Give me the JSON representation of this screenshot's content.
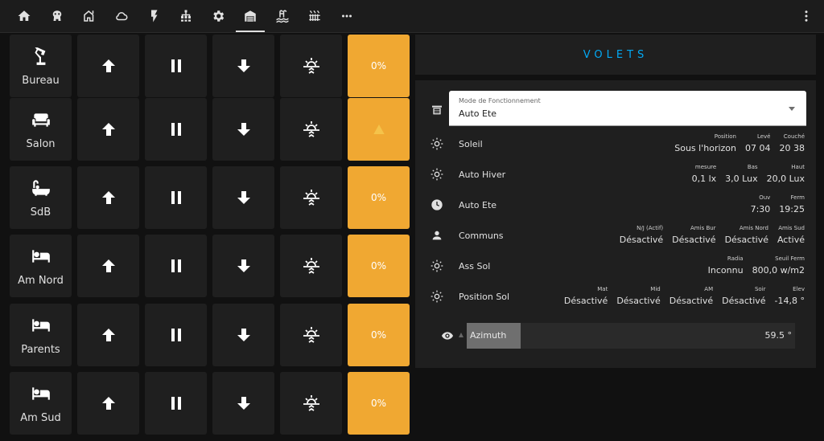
{
  "tabs": [
    {
      "icon": "home-icon"
    },
    {
      "icon": "brain-icon"
    },
    {
      "icon": "house-outline-icon"
    },
    {
      "icon": "cloud-icon"
    },
    {
      "icon": "flash-icon"
    },
    {
      "icon": "network-icon"
    },
    {
      "icon": "gear-icon"
    },
    {
      "icon": "garage-icon",
      "active": true
    },
    {
      "icon": "pool-icon"
    },
    {
      "icon": "radiator-icon"
    },
    {
      "icon": "more-horizontal-icon"
    }
  ],
  "rooms": [
    {
      "name": "Bureau",
      "icon": "desk-lamp-icon",
      "position": "0%"
    },
    {
      "name": "Salon",
      "icon": "sofa-icon",
      "position": ""
    },
    {
      "name": "SdB",
      "icon": "bathtub-icon",
      "position": "0%"
    },
    {
      "name": "Am Nord",
      "icon": "bed-icon",
      "position": "0%"
    },
    {
      "name": "Parents",
      "icon": "bed-icon",
      "position": "0%"
    },
    {
      "name": "Am Sud",
      "icon": "bed-icon",
      "position": "0%"
    }
  ],
  "colors": {
    "accent": "#f0a832",
    "title": "#03a9f4",
    "card": "#1f1f1f",
    "background": "#111111"
  },
  "panel": {
    "title": "VOLETS",
    "mode": {
      "label": "Mode de Fonctionnement",
      "value": "Auto Ete"
    },
    "rows": [
      {
        "title": "Soleil",
        "icon": "weather-sunny-icon",
        "attrs": [
          {
            "k": "Position",
            "v": "Sous l'horizon"
          },
          {
            "k": "Levé",
            "v": "07 04"
          },
          {
            "k": "Couché",
            "v": "20 38"
          }
        ]
      },
      {
        "title": "Auto Hiver",
        "icon": "weather-sunny-icon",
        "attrs": [
          {
            "k": "mesure",
            "v": "0,1 lx"
          },
          {
            "k": "Bas",
            "v": "3,0 Lux"
          },
          {
            "k": "Haut",
            "v": "20,0 Lux"
          }
        ]
      },
      {
        "title": "Auto Ete",
        "icon": "clock-icon",
        "attrs": [
          {
            "k": "Ouv",
            "v": "7:30"
          },
          {
            "k": "Ferm",
            "v": "19:25"
          }
        ]
      },
      {
        "title": "Communs",
        "icon": "account-icon",
        "attrs": [
          {
            "k": "N/J (Actif)",
            "v": "Désactivé"
          },
          {
            "k": "Amis Bur",
            "v": "Désactivé"
          },
          {
            "k": "Amis Nord",
            "v": "Désactivé"
          },
          {
            "k": "Amis Sud",
            "v": "Activé"
          }
        ]
      },
      {
        "title": "Ass Sol",
        "icon": "weather-sunny-icon",
        "attrs": [
          {
            "k": "Radia",
            "v": "Inconnu"
          },
          {
            "k": "Seuil Ferm",
            "v": "800,0 w/m2"
          }
        ]
      },
      {
        "title": "Position Sol",
        "icon": "weather-sunny-icon",
        "attrs": [
          {
            "k": "Mat",
            "v": "Désactivé"
          },
          {
            "k": "Mid",
            "v": "Désactivé"
          },
          {
            "k": "AM",
            "v": "Désactivé"
          },
          {
            "k": "Soir",
            "v": "Désactivé"
          },
          {
            "k": "Elev",
            "v": "-14,8 °"
          }
        ]
      }
    ],
    "slider": {
      "label": "Azimuth",
      "value": "59.5 °",
      "fraction": 0.165
    }
  }
}
